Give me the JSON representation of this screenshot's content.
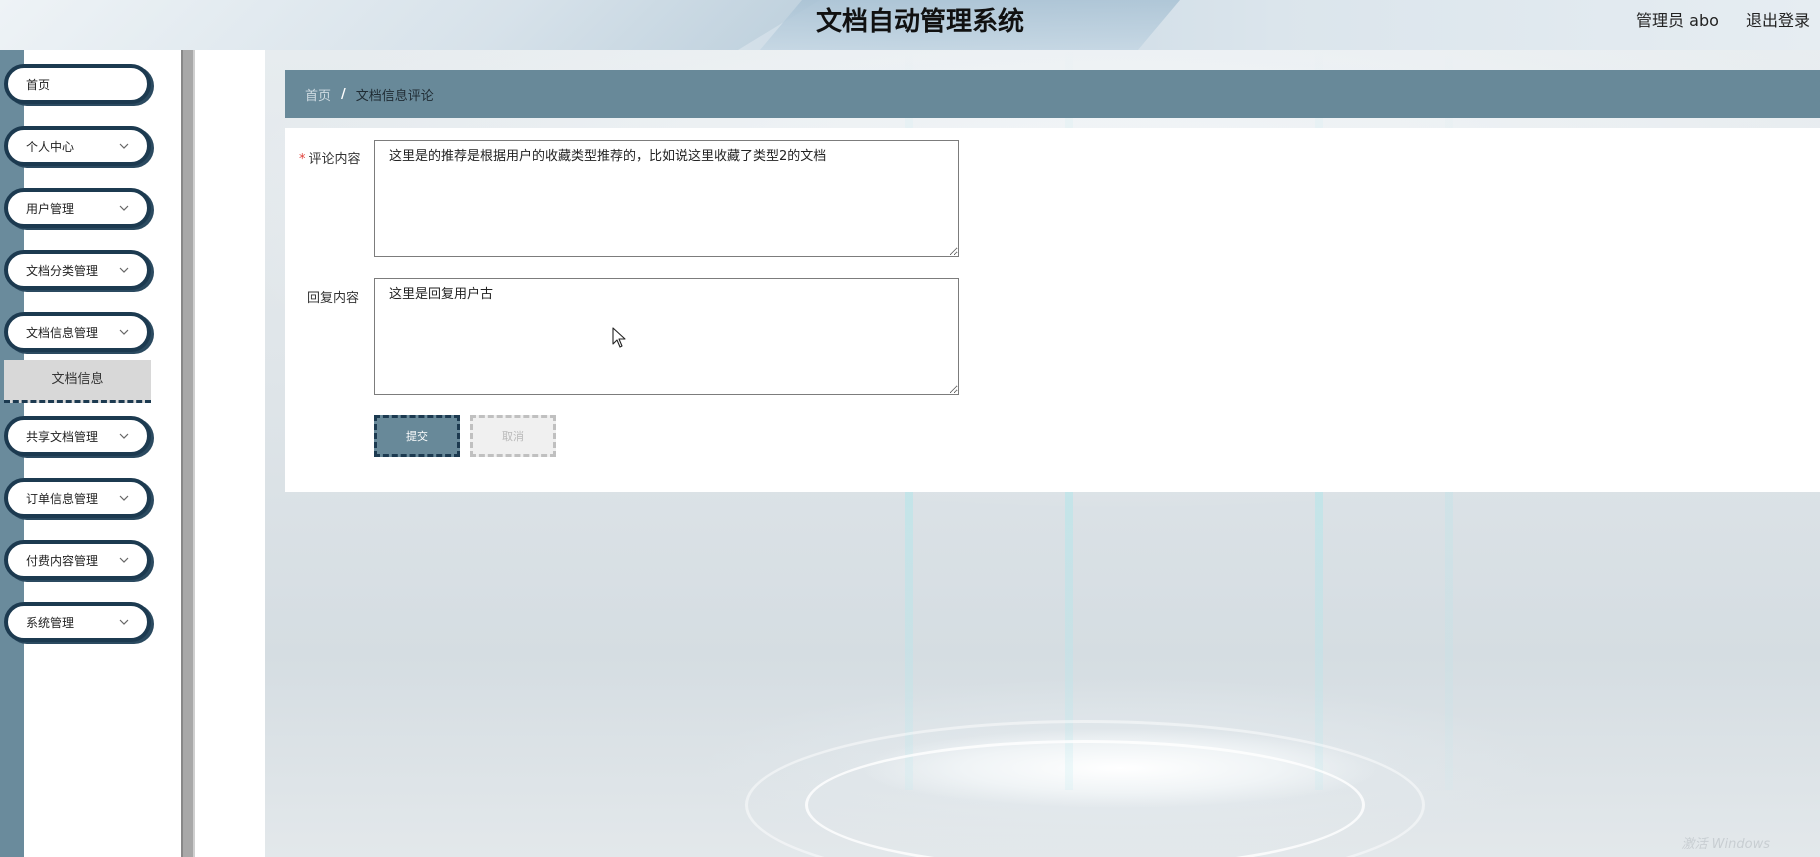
{
  "header": {
    "title": "文档自动管理系统",
    "user_label": "管理员 abo",
    "logout_label": "退出登录"
  },
  "sidebar": {
    "items": [
      {
        "label": "首页",
        "has_arrow": false
      },
      {
        "label": "个人中心",
        "has_arrow": true
      },
      {
        "label": "用户管理",
        "has_arrow": true
      },
      {
        "label": "文档分类管理",
        "has_arrow": true
      },
      {
        "label": "文档信息管理",
        "has_arrow": true
      },
      {
        "label": "共享文档管理",
        "has_arrow": true
      },
      {
        "label": "订单信息管理",
        "has_arrow": true
      },
      {
        "label": "付费内容管理",
        "has_arrow": true
      },
      {
        "label": "系统管理",
        "has_arrow": true
      }
    ],
    "active_submenu": {
      "label": "文档信息"
    }
  },
  "breadcrumb": {
    "home": "首页",
    "separator": "/",
    "current": "文档信息评论"
  },
  "form": {
    "comment": {
      "label": "评论内容",
      "required_mark": "*",
      "value": "这里是的推荐是根据用户的收藏类型推荐的，比如说这里收藏了类型2的文档"
    },
    "reply": {
      "label": "回复内容",
      "value": "这里是回复用户古"
    },
    "submit_label": "提交",
    "cancel_label": "取消"
  },
  "watermark": "激活 Windows"
}
